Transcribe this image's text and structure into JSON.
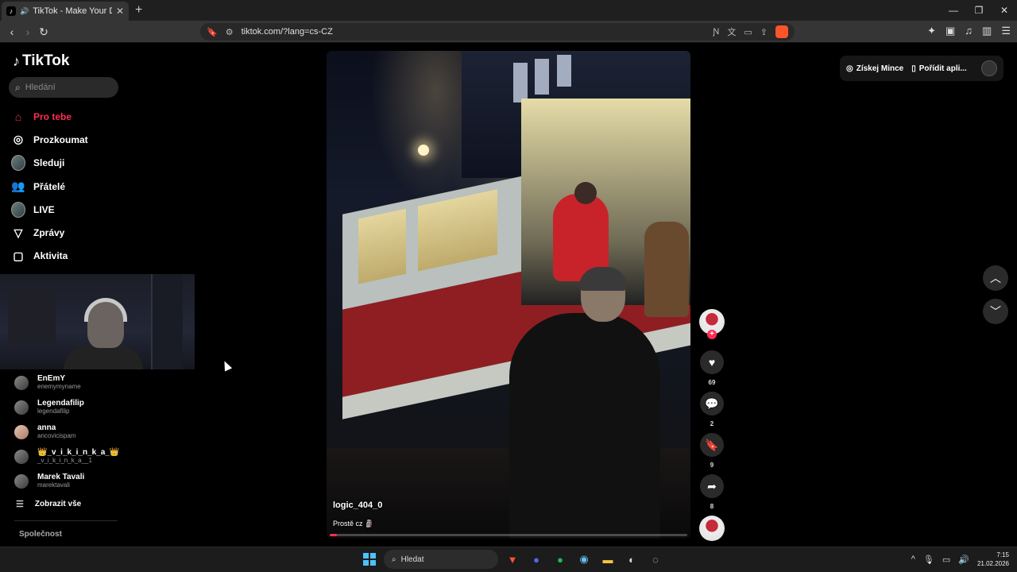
{
  "browser": {
    "tab_title": "TikTok - Make Your Day",
    "url": "tiktok.com/?lang=cs-CZ"
  },
  "sidebar": {
    "logo": "TikTok",
    "search_placeholder": "Hledání",
    "nav": [
      {
        "label": "Pro tebe",
        "icon": "home-icon",
        "active": true
      },
      {
        "label": "Prozkoumat",
        "icon": "compass-icon"
      },
      {
        "label": "Sleduji",
        "icon": "avatar"
      },
      {
        "label": "Přátelé",
        "icon": "people-icon"
      },
      {
        "label": "LIVE",
        "icon": "avatar"
      },
      {
        "label": "Zprávy",
        "icon": "send-icon"
      },
      {
        "label": "Aktivita",
        "icon": "message-icon"
      }
    ],
    "following": [
      {
        "name": "EnEmY",
        "handle": "enemymyname"
      },
      {
        "name": "Legendafilip",
        "handle": "legendafilip"
      },
      {
        "name": "anna",
        "handle": "ancovicispam"
      },
      {
        "name": "👑_v_i_k_i_n_k_a_👑",
        "handle": "_v_i_k_i_n_k_a__1"
      },
      {
        "name": "Marek Tavali",
        "handle": "marektavali"
      }
    ],
    "show_all": "Zobrazit vše",
    "company": "Společnost"
  },
  "header": {
    "coins": "Získej Mince",
    "get_app": "Pořídit apli..."
  },
  "video": {
    "username": "logic_404_0",
    "description": "Prostě cz 🗿",
    "progress": 0.02
  },
  "actions": {
    "likes": "69",
    "comments": "2",
    "saves": "9",
    "shares": "8"
  },
  "taskbar": {
    "search": "Hledat",
    "time": "7:15",
    "date": "21.02.2026"
  }
}
